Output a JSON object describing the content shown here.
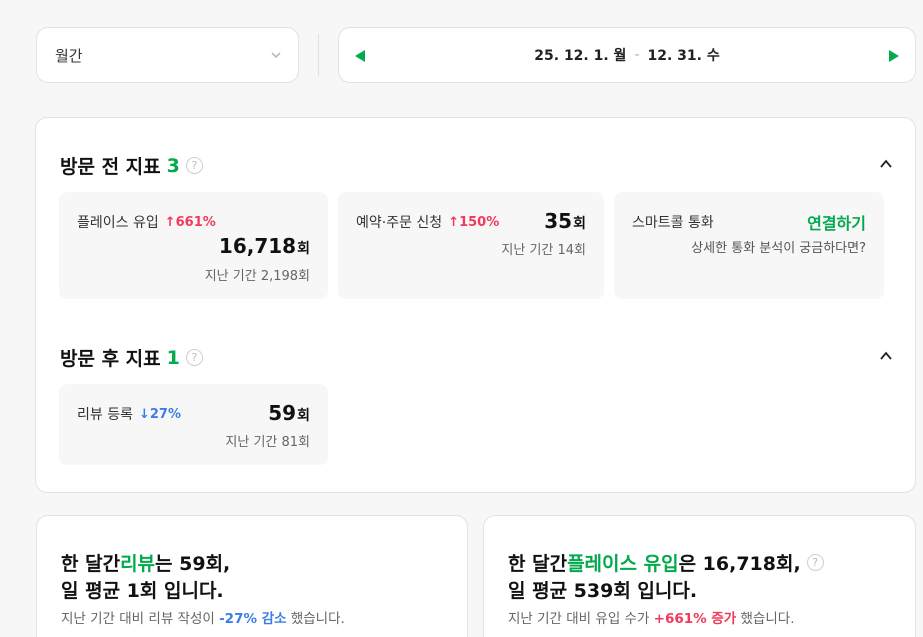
{
  "period": {
    "selected": "월간"
  },
  "date_range": {
    "start": "25. 12. 1. 월",
    "separator": "-",
    "end": "12. 31. 수"
  },
  "pre_visit": {
    "title": "방문 전 지표",
    "count": "3",
    "help": "?",
    "tiles": [
      {
        "label": "플레이스 유입",
        "change": "↑661%",
        "value": "16,718",
        "unit": "회",
        "prev": "지난 기간 2,198회"
      },
      {
        "label": "예약·주문 신청",
        "change": "↑150%",
        "value": "35",
        "unit": "회",
        "prev": "지난 기간 14회"
      },
      {
        "label": "스마트콜 통화",
        "link": "연결하기",
        "sub": "상세한 통화 분석이 궁금하다면?"
      }
    ]
  },
  "post_visit": {
    "title": "방문 후 지표",
    "count": "1",
    "help": "?",
    "tiles": [
      {
        "label": "리뷰 등록",
        "change": "↓27%",
        "value": "59",
        "unit": "회",
        "prev": "지난 기간 81회"
      }
    ]
  },
  "summaries": [
    {
      "l1_pre": "한 달간 ",
      "l1_hl": "리뷰",
      "l1_post": "는 59회,",
      "l2": "일 평균 1회 입니다.",
      "f_pre": "지난 기간 대비 리뷰 작성이 ",
      "f_val": "-27% 감소",
      "f_post": " 했습니다."
    },
    {
      "l1_pre": "한 달간 ",
      "l1_hl": "플레이스 유입",
      "l1_post": "은 16,718회,",
      "help": "?",
      "l2": "일 평균 539회 입니다.",
      "f_pre": "지난 기간 대비 유입 수가 ",
      "f_val": "+661% 증가",
      "f_post": " 했습니다."
    }
  ],
  "colors": {
    "accent": "#03a94d",
    "up": "#f2395b",
    "down": "#3c7de6"
  }
}
